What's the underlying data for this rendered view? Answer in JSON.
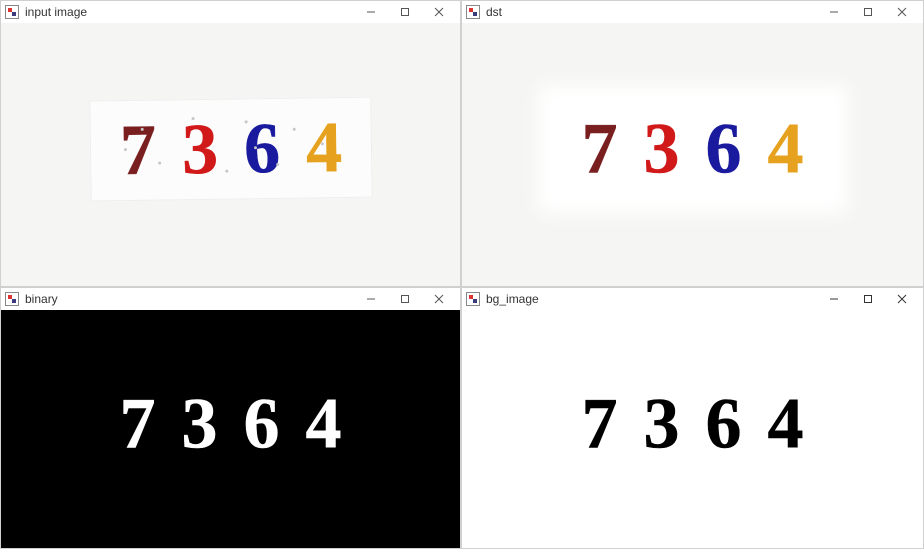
{
  "windows": {
    "input": {
      "title": "input image"
    },
    "dst": {
      "title": "dst"
    },
    "binary": {
      "title": "binary"
    },
    "bg": {
      "title": "bg_image"
    }
  },
  "digits": {
    "d1": {
      "char": "7",
      "color": "#7a1f1f"
    },
    "d2": {
      "char": "3",
      "color": "#d11919"
    },
    "d3": {
      "char": "6",
      "color": "#1a1a9e"
    },
    "d4": {
      "char": "4",
      "color": "#e6a21f"
    }
  },
  "icons": {
    "minimize": "minimize-icon",
    "maximize": "maximize-icon",
    "close": "close-icon"
  }
}
